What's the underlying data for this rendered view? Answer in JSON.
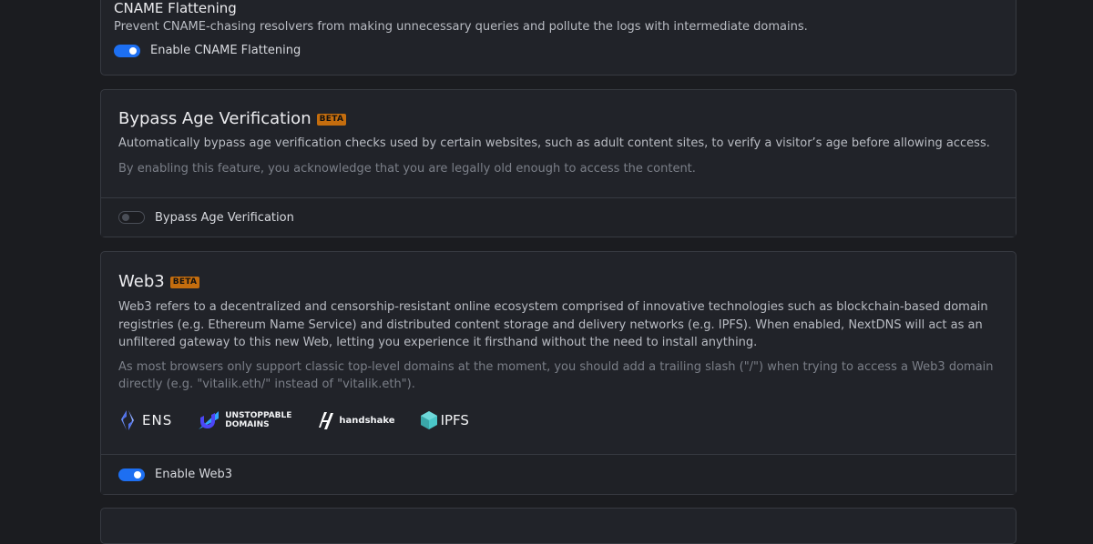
{
  "cname": {
    "title": "CNAME Flattening",
    "description": "Prevent CNAME-chasing resolvers from making unnecessary queries and pollute the logs with intermediate domains.",
    "toggle_label": "Enable CNAME Flattening",
    "enabled": true
  },
  "bypass": {
    "title": "Bypass Age Verification",
    "badge": "BETA",
    "description": "Automatically bypass age verification checks used by certain websites, such as adult content sites, to verify a visitor’s age before allowing access.",
    "note": "By enabling this feature, you acknowledge that you are legally old enough to access the content.",
    "toggle_label": "Bypass Age Verification",
    "enabled": false
  },
  "web3": {
    "title": "Web3",
    "badge": "BETA",
    "description": "Web3 refers to a decentralized and censorship-resistant online ecosystem comprised of innovative technologies such as blockchain-based domain registries (e.g. Ethereum Name Service) and distributed content storage and delivery networks (e.g. IPFS). When enabled, NextDNS will act as an unfiltered gateway to this new Web, letting you experience it firsthand without the need to install anything.",
    "note": "As most browsers only support classic top-level domains at the moment, you should add a trailing slash (\"/\") when trying to access a Web3 domain directly (e.g. \"vitalik.eth/\" instead of \"vitalik.eth\").",
    "logos": {
      "ens": "ENS",
      "unstoppable_line1": "UNSTOPPABLE",
      "unstoppable_line2": "DOMAINS",
      "handshake": "handshake",
      "ipfs": "IPFS"
    },
    "toggle_label": "Enable Web3",
    "enabled": true
  },
  "colors": {
    "accent": "#1d6ff2",
    "beta": "#c46d0e",
    "ens": "#5b7df4",
    "unstoppable": "#4c47f7",
    "ipfs": "#4ac6c8"
  }
}
